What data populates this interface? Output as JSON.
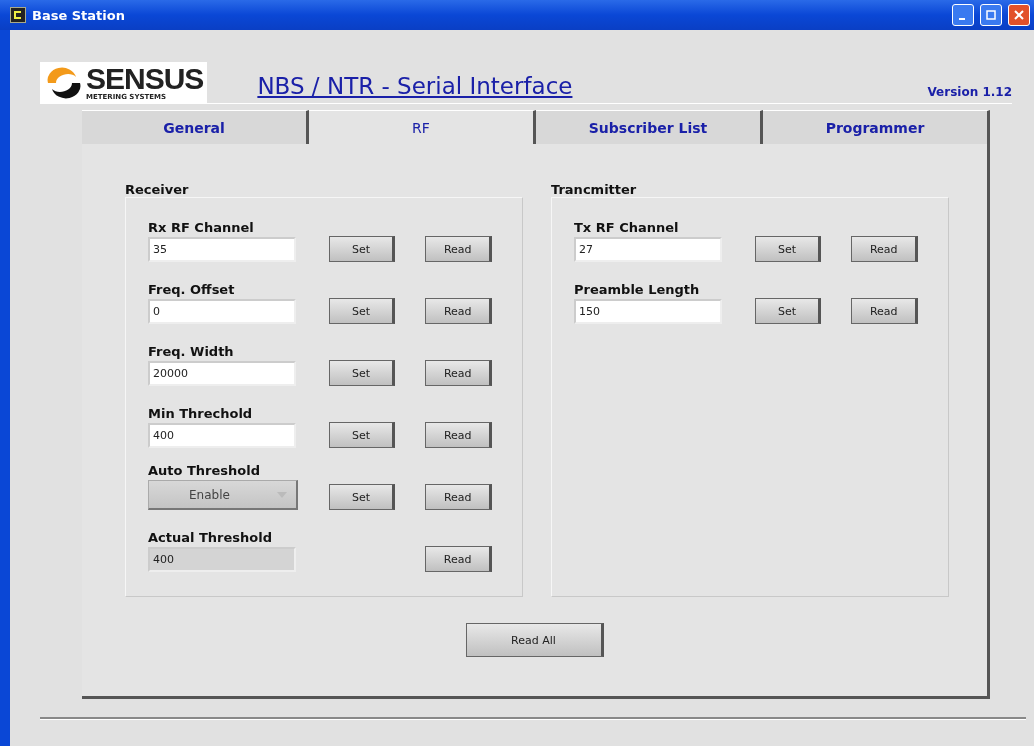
{
  "window": {
    "title": "Base Station"
  },
  "header": {
    "logo_name": "SENSUS",
    "logo_tagline": "METERING SYSTEMS",
    "title": "NBS / NTR - Serial Interface",
    "version": "Version 1.12"
  },
  "tabs": [
    {
      "label": "General",
      "selected": false
    },
    {
      "label": "RF",
      "selected": true
    },
    {
      "label": "Subscriber List",
      "selected": false
    },
    {
      "label": "Programmer",
      "selected": false
    }
  ],
  "groups": [
    {
      "title": "Receiver",
      "rows": [
        {
          "kind": "input",
          "label": "Rx RF Channel",
          "value": "35",
          "set": "Set",
          "read": "Read"
        },
        {
          "kind": "input",
          "label": "Freq. Offset",
          "value": "0",
          "set": "Set",
          "read": "Read"
        },
        {
          "kind": "input",
          "label": "Freq. Width",
          "value": "20000",
          "set": "Set",
          "read": "Read"
        },
        {
          "kind": "input",
          "label": "Min Threchold",
          "value": "400",
          "set": "Set",
          "read": "Read"
        },
        {
          "kind": "dropdown",
          "label": "Auto Threshold",
          "value": "Enable",
          "set": "Set",
          "read": "Read"
        },
        {
          "kind": "display",
          "label": "Actual Threshold",
          "value": "400",
          "read": "Read"
        }
      ]
    },
    {
      "title": "Trancmitter",
      "rows": [
        {
          "kind": "input",
          "label": "Tx RF Channel",
          "value": "27",
          "set": "Set",
          "read": "Read"
        },
        {
          "kind": "input",
          "label": "Preamble Length",
          "value": "150",
          "set": "Set",
          "read": "Read"
        }
      ]
    }
  ],
  "read_all": "Read All"
}
